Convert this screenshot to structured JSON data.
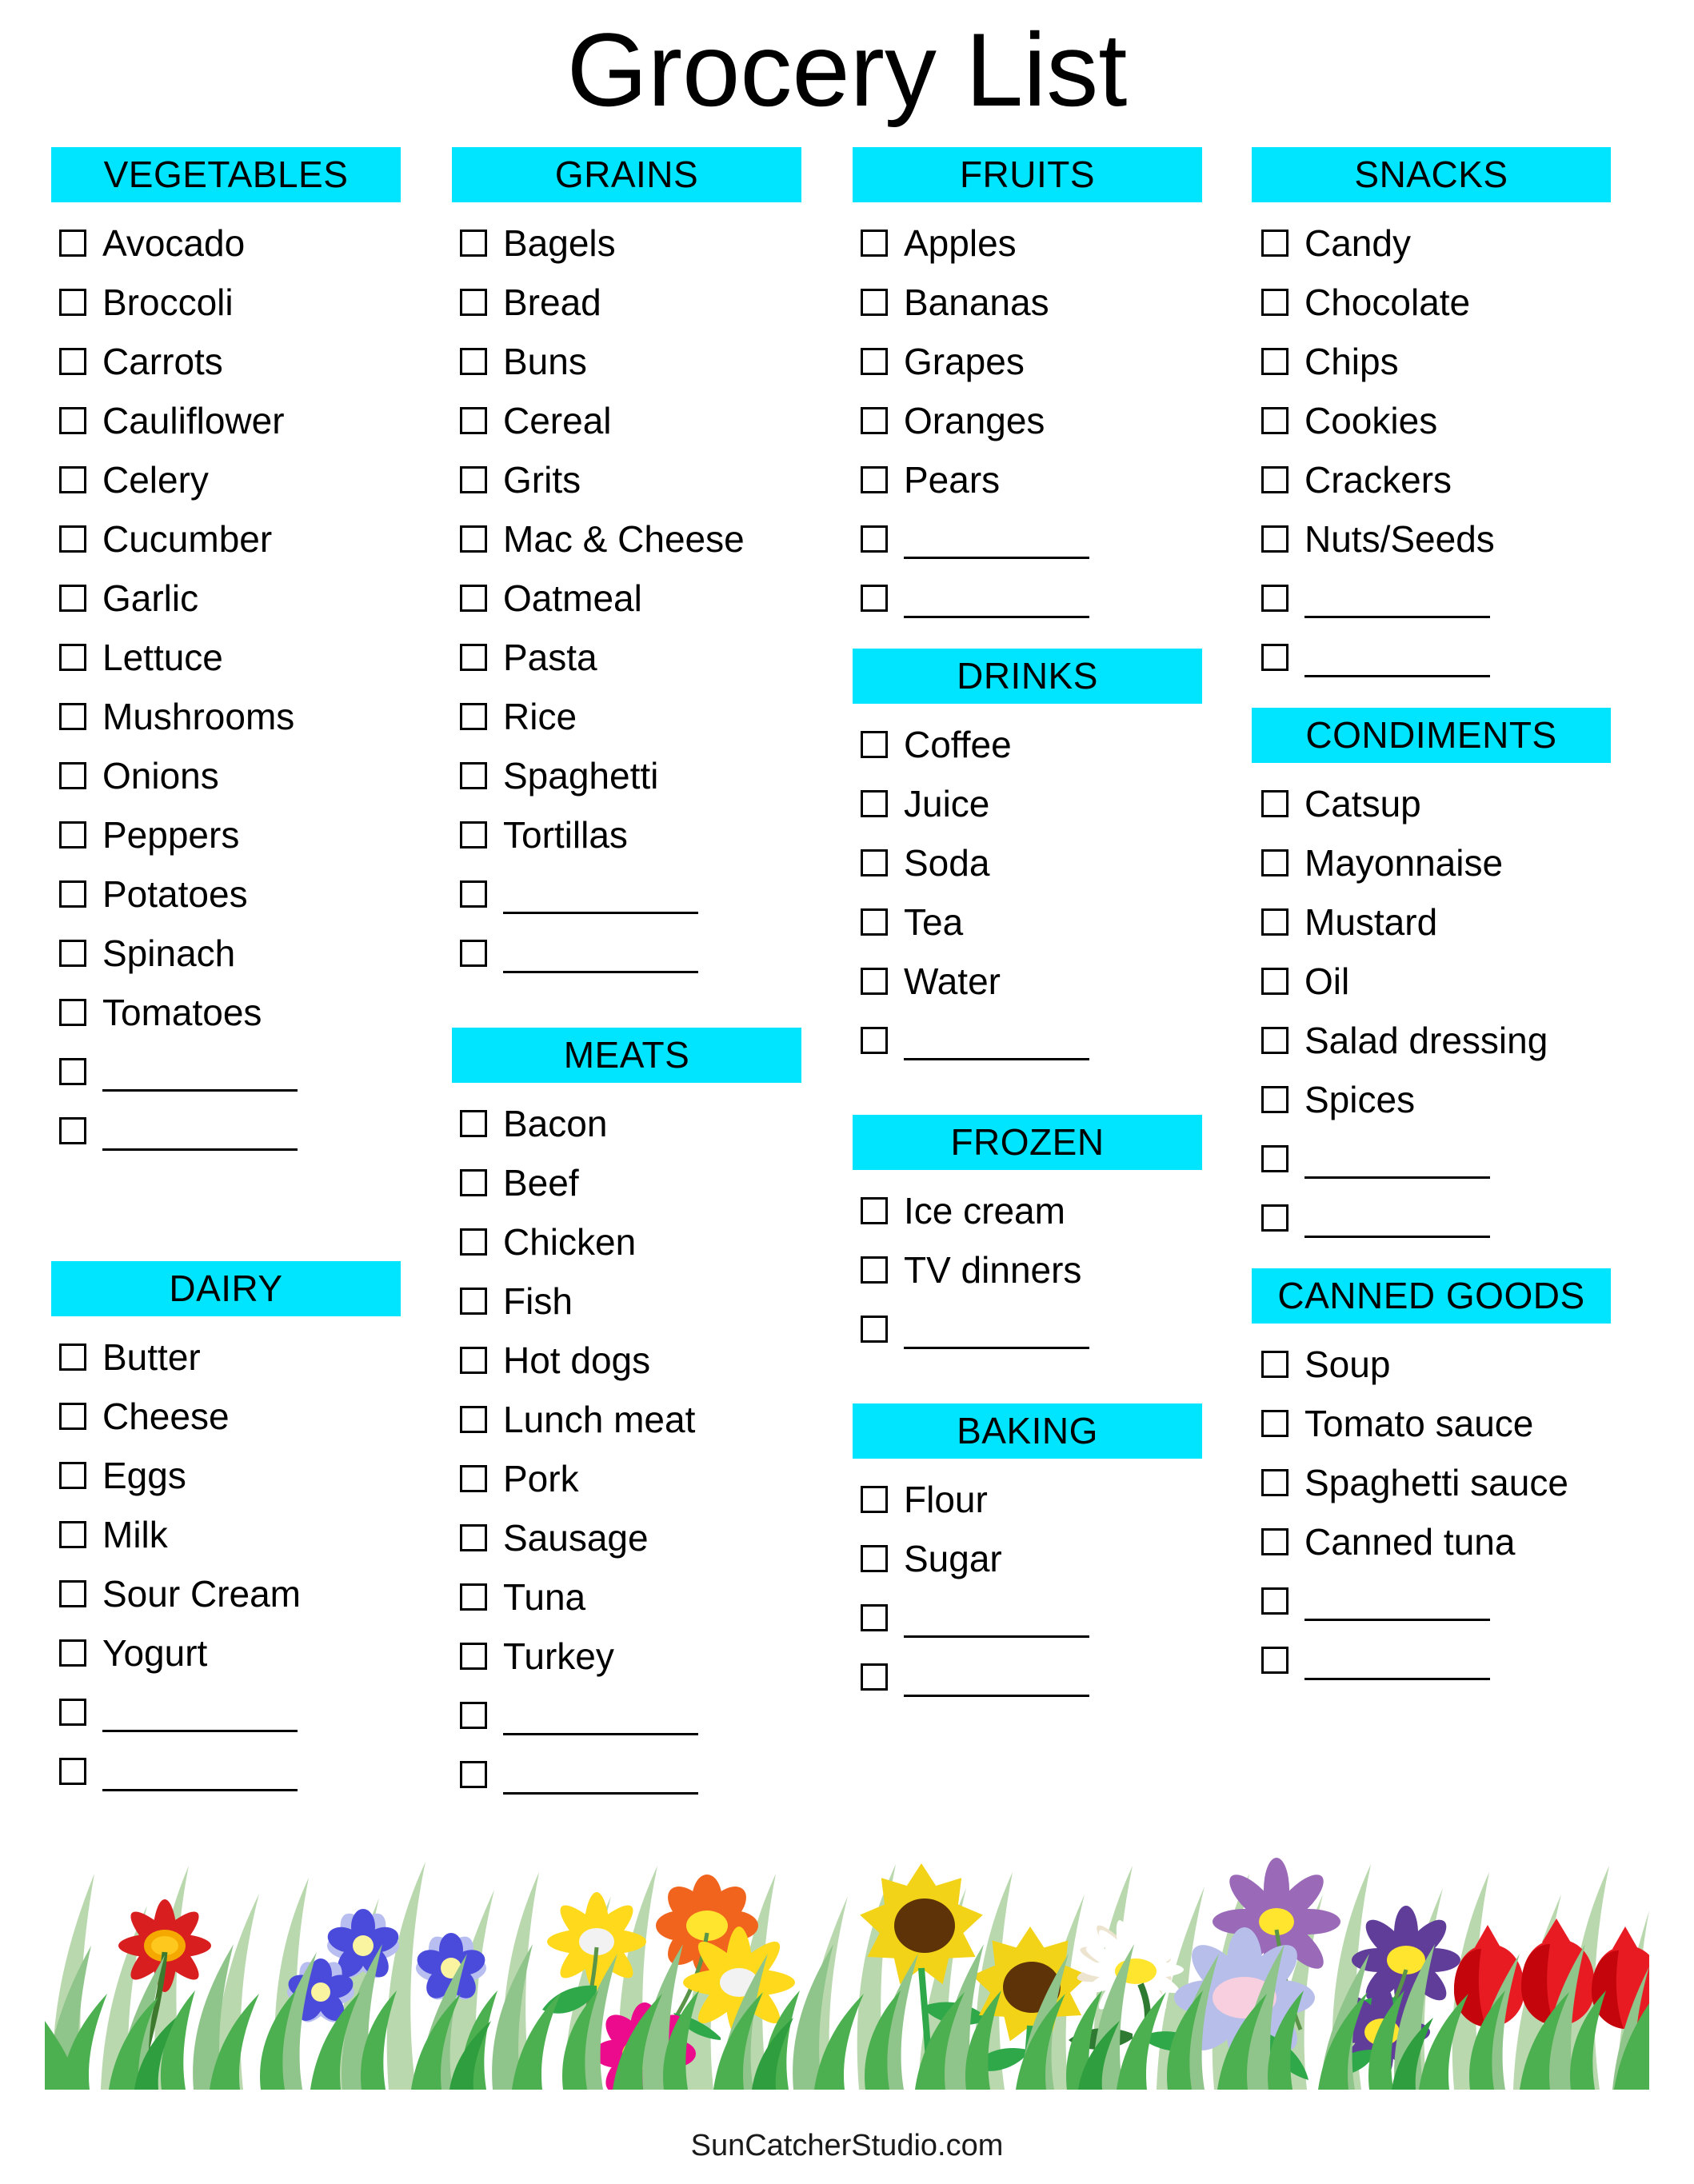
{
  "page": {
    "title": "Grocery List",
    "footer": "SunCatcherStudio.com",
    "accent_color": "#00E5FF",
    "text_color": "#000000",
    "background_color": "#FFFFFF"
  },
  "columns": [
    {
      "id": "column-1",
      "sections": [
        {
          "id": "vegetables",
          "title": "VEGETABLES",
          "items": [
            "Avocado",
            "Broccoli",
            "Carrots",
            "Cauliflower",
            "Celery",
            "Cucumber",
            "Garlic",
            "Lettuce",
            "Mushrooms",
            "Onions",
            "Peppers",
            "Potatoes",
            "Spinach",
            "Tomatoes"
          ],
          "blank_lines": 2
        },
        {
          "id": "dairy",
          "title": "DAIRY",
          "items": [
            "Butter",
            "Cheese",
            "Eggs",
            "Milk",
            "Sour Cream",
            "Yogurt"
          ],
          "blank_lines": 2
        }
      ]
    },
    {
      "id": "column-2",
      "sections": [
        {
          "id": "grains",
          "title": "GRAINS",
          "items": [
            "Bagels",
            "Bread",
            "Buns",
            "Cereal",
            "Grits",
            "Mac & Cheese",
            "Oatmeal",
            "Pasta",
            "Rice",
            "Spaghetti",
            "Tortillas"
          ],
          "blank_lines": 2
        },
        {
          "id": "meats",
          "title": "MEATS",
          "items": [
            "Bacon",
            "Beef",
            "Chicken",
            "Fish",
            "Hot dogs",
            "Lunch meat",
            "Pork",
            "Sausage",
            "Tuna",
            "Turkey"
          ],
          "blank_lines": 2
        }
      ]
    },
    {
      "id": "column-3",
      "sections": [
        {
          "id": "fruits",
          "title": "FRUITS",
          "items": [
            "Apples",
            "Bananas",
            "Grapes",
            "Oranges",
            "Pears"
          ],
          "blank_lines": 2
        },
        {
          "id": "drinks",
          "title": "DRINKS",
          "items": [
            "Coffee",
            "Juice",
            "Soda",
            "Tea",
            "Water"
          ],
          "blank_lines": 1
        },
        {
          "id": "frozen",
          "title": "FROZEN",
          "items": [
            "Ice cream",
            "TV dinners"
          ],
          "blank_lines": 1
        },
        {
          "id": "baking",
          "title": "BAKING",
          "items": [
            "Flour",
            "Sugar"
          ],
          "blank_lines": 2
        }
      ]
    },
    {
      "id": "column-4",
      "sections": [
        {
          "id": "snacks",
          "title": "SNACKS",
          "items": [
            "Candy",
            "Chocolate",
            "Chips",
            "Cookies",
            "Crackers",
            "Nuts/Seeds"
          ],
          "blank_lines": 2
        },
        {
          "id": "condiments",
          "title": "CONDIMENTS",
          "items": [
            "Catsup",
            "Mayonnaise",
            "Mustard",
            "Oil",
            "Salad dressing",
            "Spices"
          ],
          "blank_lines": 2
        },
        {
          "id": "canned-goods",
          "title": "CANNED GOODS",
          "items": [
            "Soup",
            "Tomato sauce",
            "Spaghetti sauce",
            "Canned tuna"
          ],
          "blank_lines": 2
        }
      ]
    }
  ],
  "decoration": {
    "id": "flower-grass-border",
    "description": "Illustrated strip of green grass with assorted flowers",
    "flowers": [
      {
        "name": "red-daisy",
        "petal_color": "#D81E1E",
        "center_color": "#F5A800"
      },
      {
        "name": "blue-daisy",
        "petal_color": "#4A4ADB",
        "center_color": "#FAF3A0"
      },
      {
        "name": "blue-daisy",
        "petal_color": "#4A4ADB",
        "center_color": "#FAF3A0"
      },
      {
        "name": "blue-daisy",
        "petal_color": "#4A4ADB",
        "center_color": "#FAF3A0"
      },
      {
        "name": "yellow-daisy",
        "petal_color": "#FFD91C",
        "center_color": "#F2F2F2"
      },
      {
        "name": "orange-daisy",
        "petal_color": "#F0641E",
        "center_color": "#FFE52E"
      },
      {
        "name": "yellow-daisy",
        "petal_color": "#FFD91C",
        "center_color": "#F2F2F2"
      },
      {
        "name": "magenta-daisy",
        "petal_color": "#EC0B8C",
        "center_color": "#FFE52E"
      },
      {
        "name": "sunflower",
        "petal_color": "#F2D318",
        "center_color": "#5E3308"
      },
      {
        "name": "sunflower",
        "petal_color": "#F2D318",
        "center_color": "#5E3308"
      },
      {
        "name": "white-daisy",
        "petal_color": "#FFFFFF",
        "center_color": "#FFE52E"
      },
      {
        "name": "purple-daisy",
        "petal_color": "#9A69B8",
        "center_color": "#FFE52E"
      },
      {
        "name": "periwinkle-daisy",
        "petal_color": "#B7BEEA",
        "center_color": "#F7CFDE"
      },
      {
        "name": "violet-daisy",
        "petal_color": "#5F3D99",
        "center_color": "#FFE52E"
      },
      {
        "name": "violet-daisy",
        "petal_color": "#5F3D99",
        "center_color": "#FFE52E"
      },
      {
        "name": "red-tulip",
        "petal_color": "#E81B23",
        "center_color": "#C4060C"
      },
      {
        "name": "red-tulip",
        "petal_color": "#E81B23",
        "center_color": "#C4060C"
      },
      {
        "name": "red-tulip",
        "petal_color": "#E81B23",
        "center_color": "#C4060C"
      }
    ],
    "grass_colors": [
      "#4CAF50",
      "#B3D6A8",
      "#2E9E3E",
      "#8FC48A"
    ]
  }
}
